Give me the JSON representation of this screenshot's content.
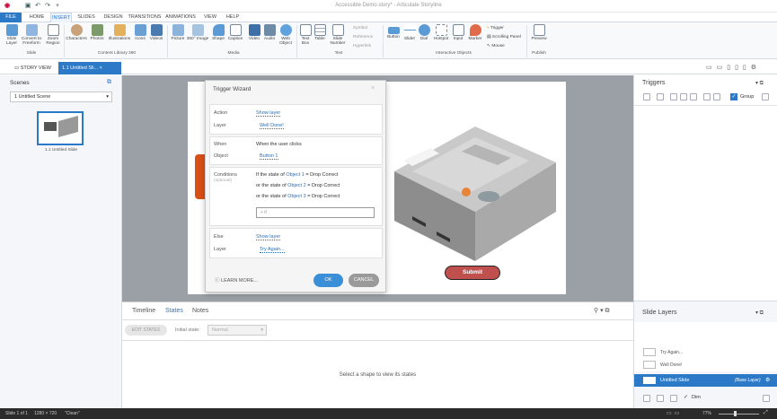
{
  "window": {
    "title": "Accessible Demo.story* - Articulate Storyline"
  },
  "menu": {
    "file": "FILE",
    "home": "HOME",
    "insert": "INSERT",
    "slides": "SLIDES",
    "design": "DESIGN",
    "transitions": "TRANSITIONS",
    "animations": "ANIMATIONS",
    "view": "VIEW",
    "help": "HELP"
  },
  "ribbon": {
    "slide_layer": "Slide\nLayer",
    "convert_freeform": "Convert to\nFreeform",
    "zoom_region": "Zoom\nRegion",
    "characters": "Characters",
    "photos": "Photos",
    "illustrations": "Illustrations",
    "icons": "Icons",
    "videos": "Videos",
    "picture": "Picture",
    "image360": "360° Image",
    "shape": "Shape",
    "caption": "Caption",
    "video": "Video",
    "audio": "Audio",
    "web_object": "Web\nObject",
    "text_box": "Text\nBox",
    "table": "Table",
    "slide_number": "Slide\nNumber",
    "symbol": "Symbol",
    "reference": "Reference",
    "hyperlink": "Hyperlink",
    "button": "Button",
    "slider": "Slider",
    "dial": "Dial",
    "hotspot": "Hotspot",
    "input": "Input",
    "marker": "Marker",
    "trigger": "Trigger",
    "scrolling_panel": "Scrolling Panel",
    "mouse": "Mouse",
    "preview": "Preview",
    "groups": {
      "slide": "Slide",
      "content_library": "Content Library 360",
      "media": "Media",
      "text": "Text",
      "interactive": "Interactive Objects",
      "publish": "Publish"
    }
  },
  "tabs": {
    "story_view": "STORY VIEW",
    "current": "1.1 Untitled Sli..."
  },
  "scenes": {
    "header": "Scenes",
    "dropdown": "1 Untitled Scene",
    "thumb_label": "1.1 Untitled Slide"
  },
  "wizard": {
    "title": "Trigger Wizard",
    "action_label": "Action",
    "action_value": "Show layer",
    "layer_label": "Layer",
    "layer_value": "Well Done!",
    "when_label": "When",
    "when_value": "When the user clicks",
    "object_label": "Object",
    "object_value": "Button 1",
    "conditions_label": "Conditions",
    "optional": "(optional)",
    "conditions": [
      {
        "prefix": "If the state of",
        "obj": "Object 1",
        "op": "=",
        "value": "Drop Correct"
      },
      {
        "prefix": "or the state of",
        "obj": "Object 2",
        "op": "=",
        "value": "Drop Correct"
      },
      {
        "prefix": "or the state of",
        "obj": "Object 3",
        "op": "=",
        "value": "Drop Correct"
      }
    ],
    "add_condition": "+ if",
    "else_label": "Else",
    "else_action": "Show layer",
    "else_layer_label": "Layer",
    "else_layer_value": "Try Again...",
    "learn_more": "LEARN MORE...",
    "ok": "OK",
    "cancel": "CANCEL"
  },
  "slide": {
    "submit": "Submit"
  },
  "bottom": {
    "tabs": [
      "Timeline",
      "States",
      "Notes"
    ],
    "edit_states": "EDIT STATES",
    "initial_state_label": "Initial state:",
    "initial_state_value": "Normal",
    "empty_msg": "Select a shape to view its states"
  },
  "triggers": {
    "header": "Triggers",
    "group_label": "Group"
  },
  "layers": {
    "header": "Slide Layers",
    "items": [
      "Try Again...",
      "Well Done!"
    ],
    "base": "Untitled Slide",
    "base_tag": "(Base Layer)",
    "dim_label": "Dim"
  },
  "status": {
    "slide": "Slide 1 of 1",
    "size": "1280 × 720",
    "state": "\"Clean\"",
    "zoom": "77%"
  },
  "colors": {
    "accent": "#2c79c8",
    "submit": "#c0504d",
    "ok": "#3a8fd6",
    "cancel": "#9a9a9a"
  }
}
